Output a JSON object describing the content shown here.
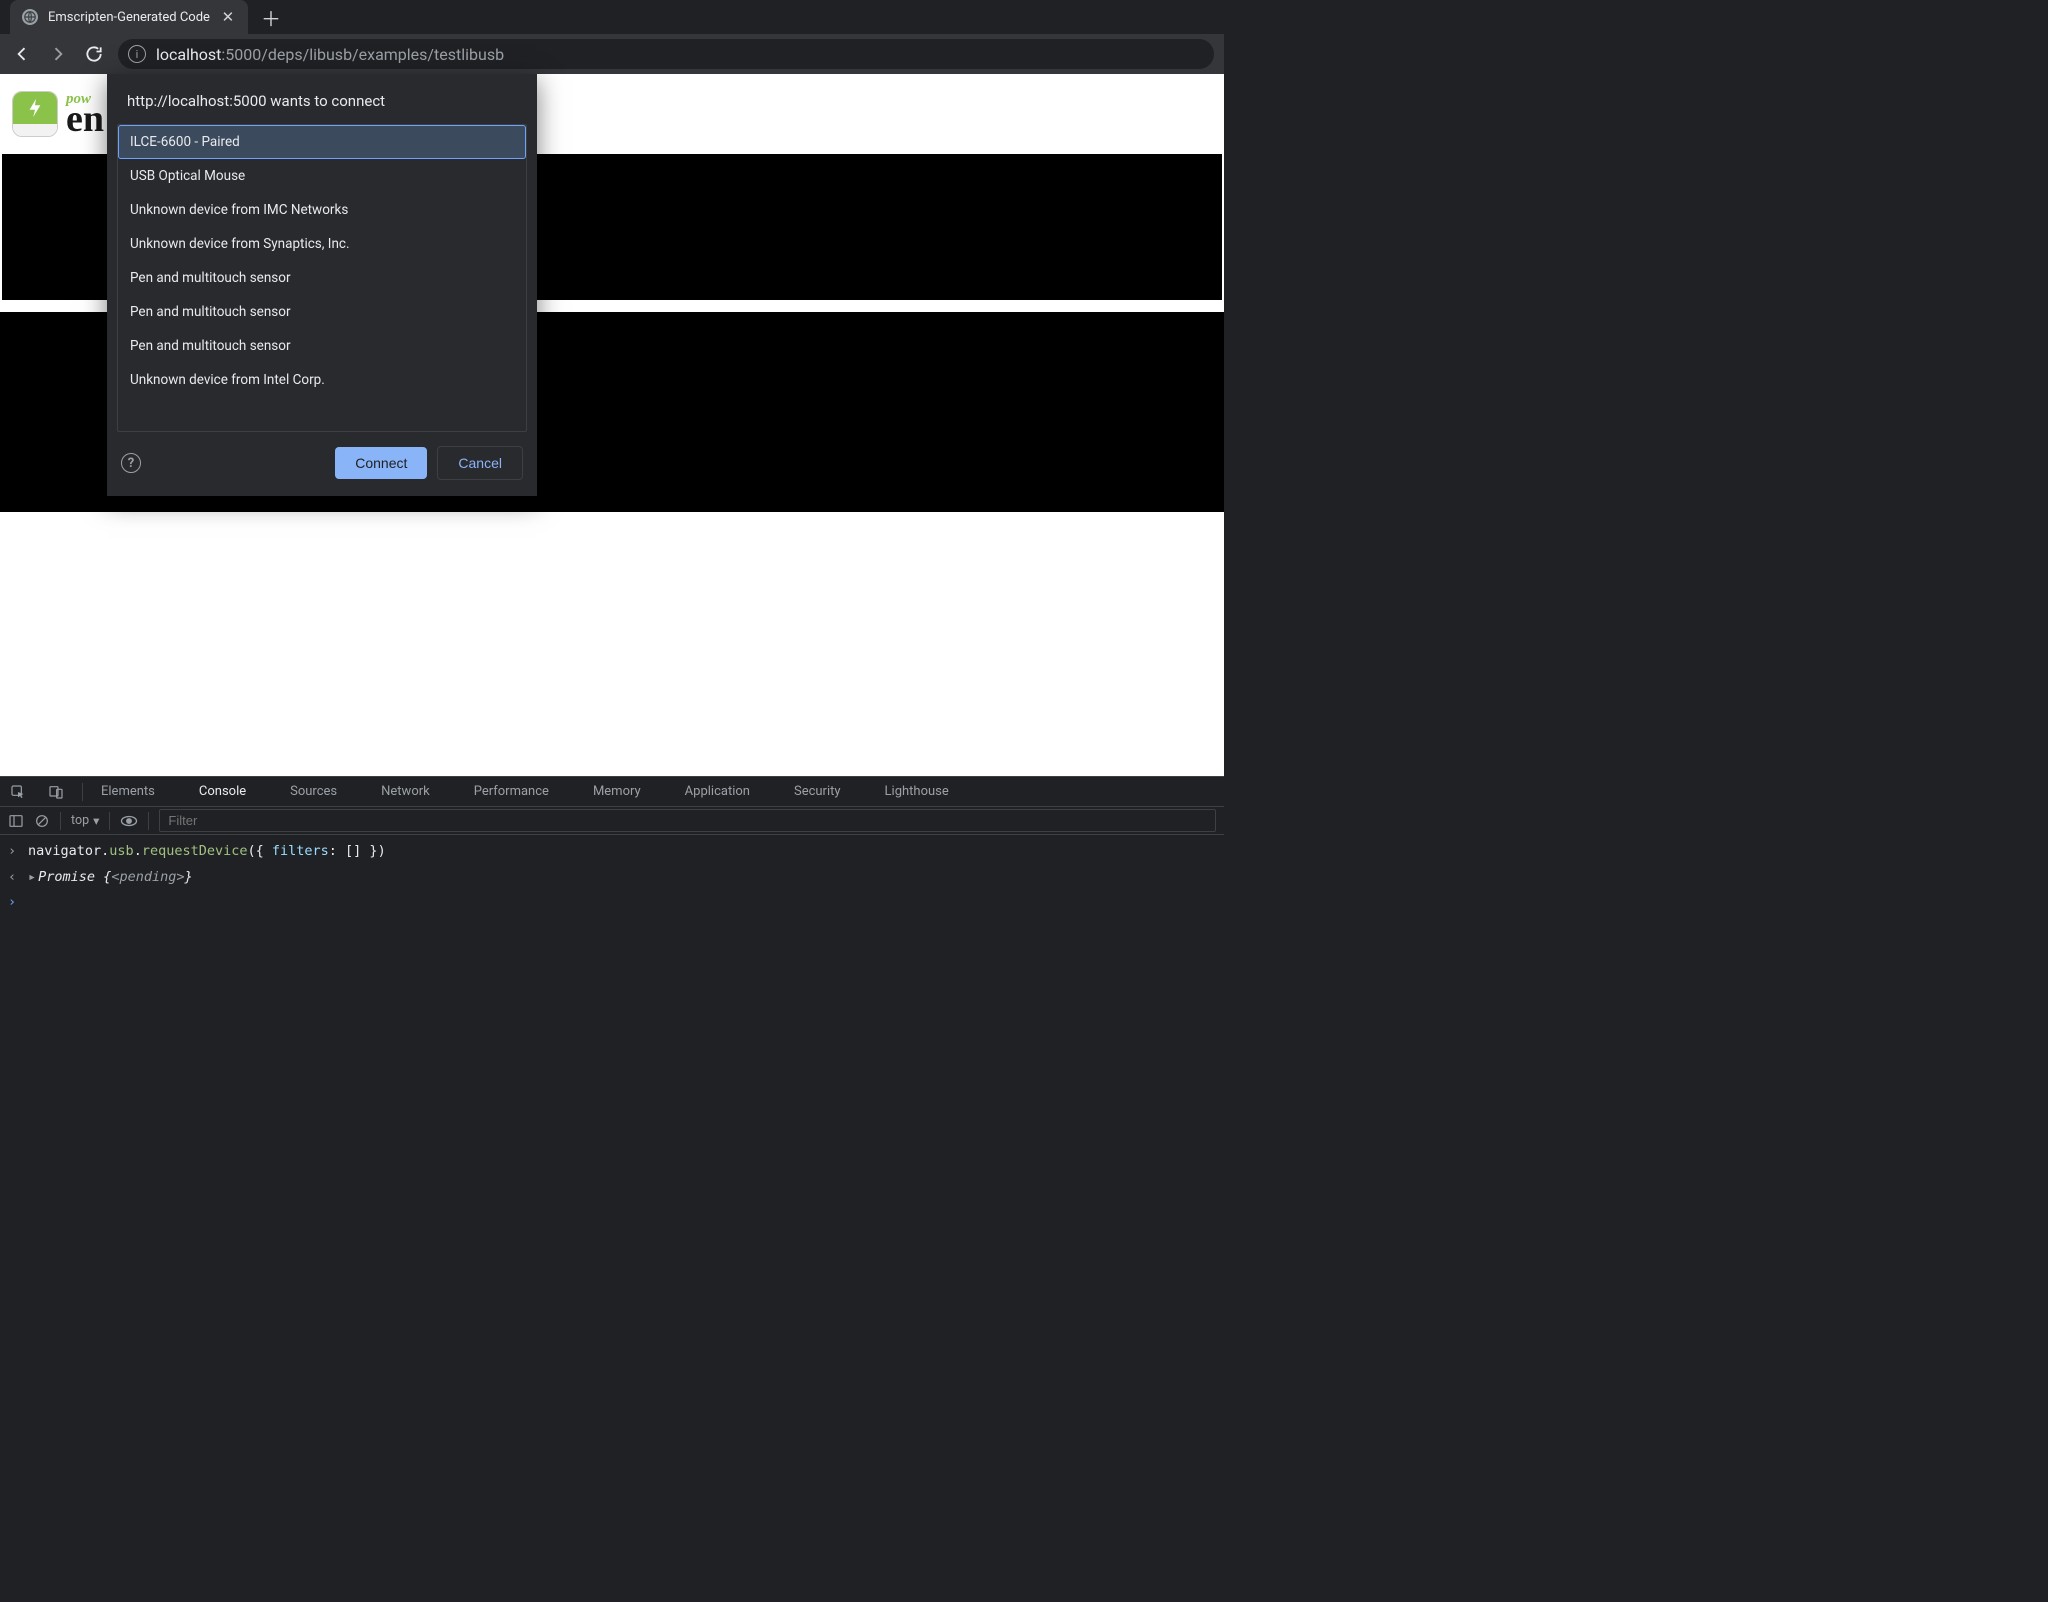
{
  "tab": {
    "title": "Emscripten-Generated Code"
  },
  "toolbar": {
    "url_host": "localhost",
    "url_port_path": ":5000/deps/libusb/examples/testlibusb"
  },
  "page": {
    "em_pow": "pow",
    "em_word": "en"
  },
  "usb": {
    "title": "http://localhost:5000 wants to connect",
    "devices": [
      {
        "label": "ILCE-6600 - Paired",
        "selected": true
      },
      {
        "label": "USB Optical Mouse",
        "selected": false
      },
      {
        "label": "Unknown device from IMC Networks",
        "selected": false
      },
      {
        "label": "Unknown device from Synaptics, Inc.",
        "selected": false
      },
      {
        "label": "Pen and multitouch sensor",
        "selected": false
      },
      {
        "label": "Pen and multitouch sensor",
        "selected": false
      },
      {
        "label": "Pen and multitouch sensor",
        "selected": false
      },
      {
        "label": "Unknown device from Intel Corp.",
        "selected": false
      }
    ],
    "connect": "Connect",
    "cancel": "Cancel"
  },
  "devtools": {
    "tabs": [
      "Elements",
      "Console",
      "Sources",
      "Network",
      "Performance",
      "Memory",
      "Application",
      "Security",
      "Lighthouse"
    ],
    "active_tab": "Console",
    "context": "top",
    "filter_placeholder": "Filter",
    "input_line": "navigator.usb.requestDevice({ filters: [] })",
    "output_prefix": "Promise",
    "output_state": "<pending>"
  }
}
